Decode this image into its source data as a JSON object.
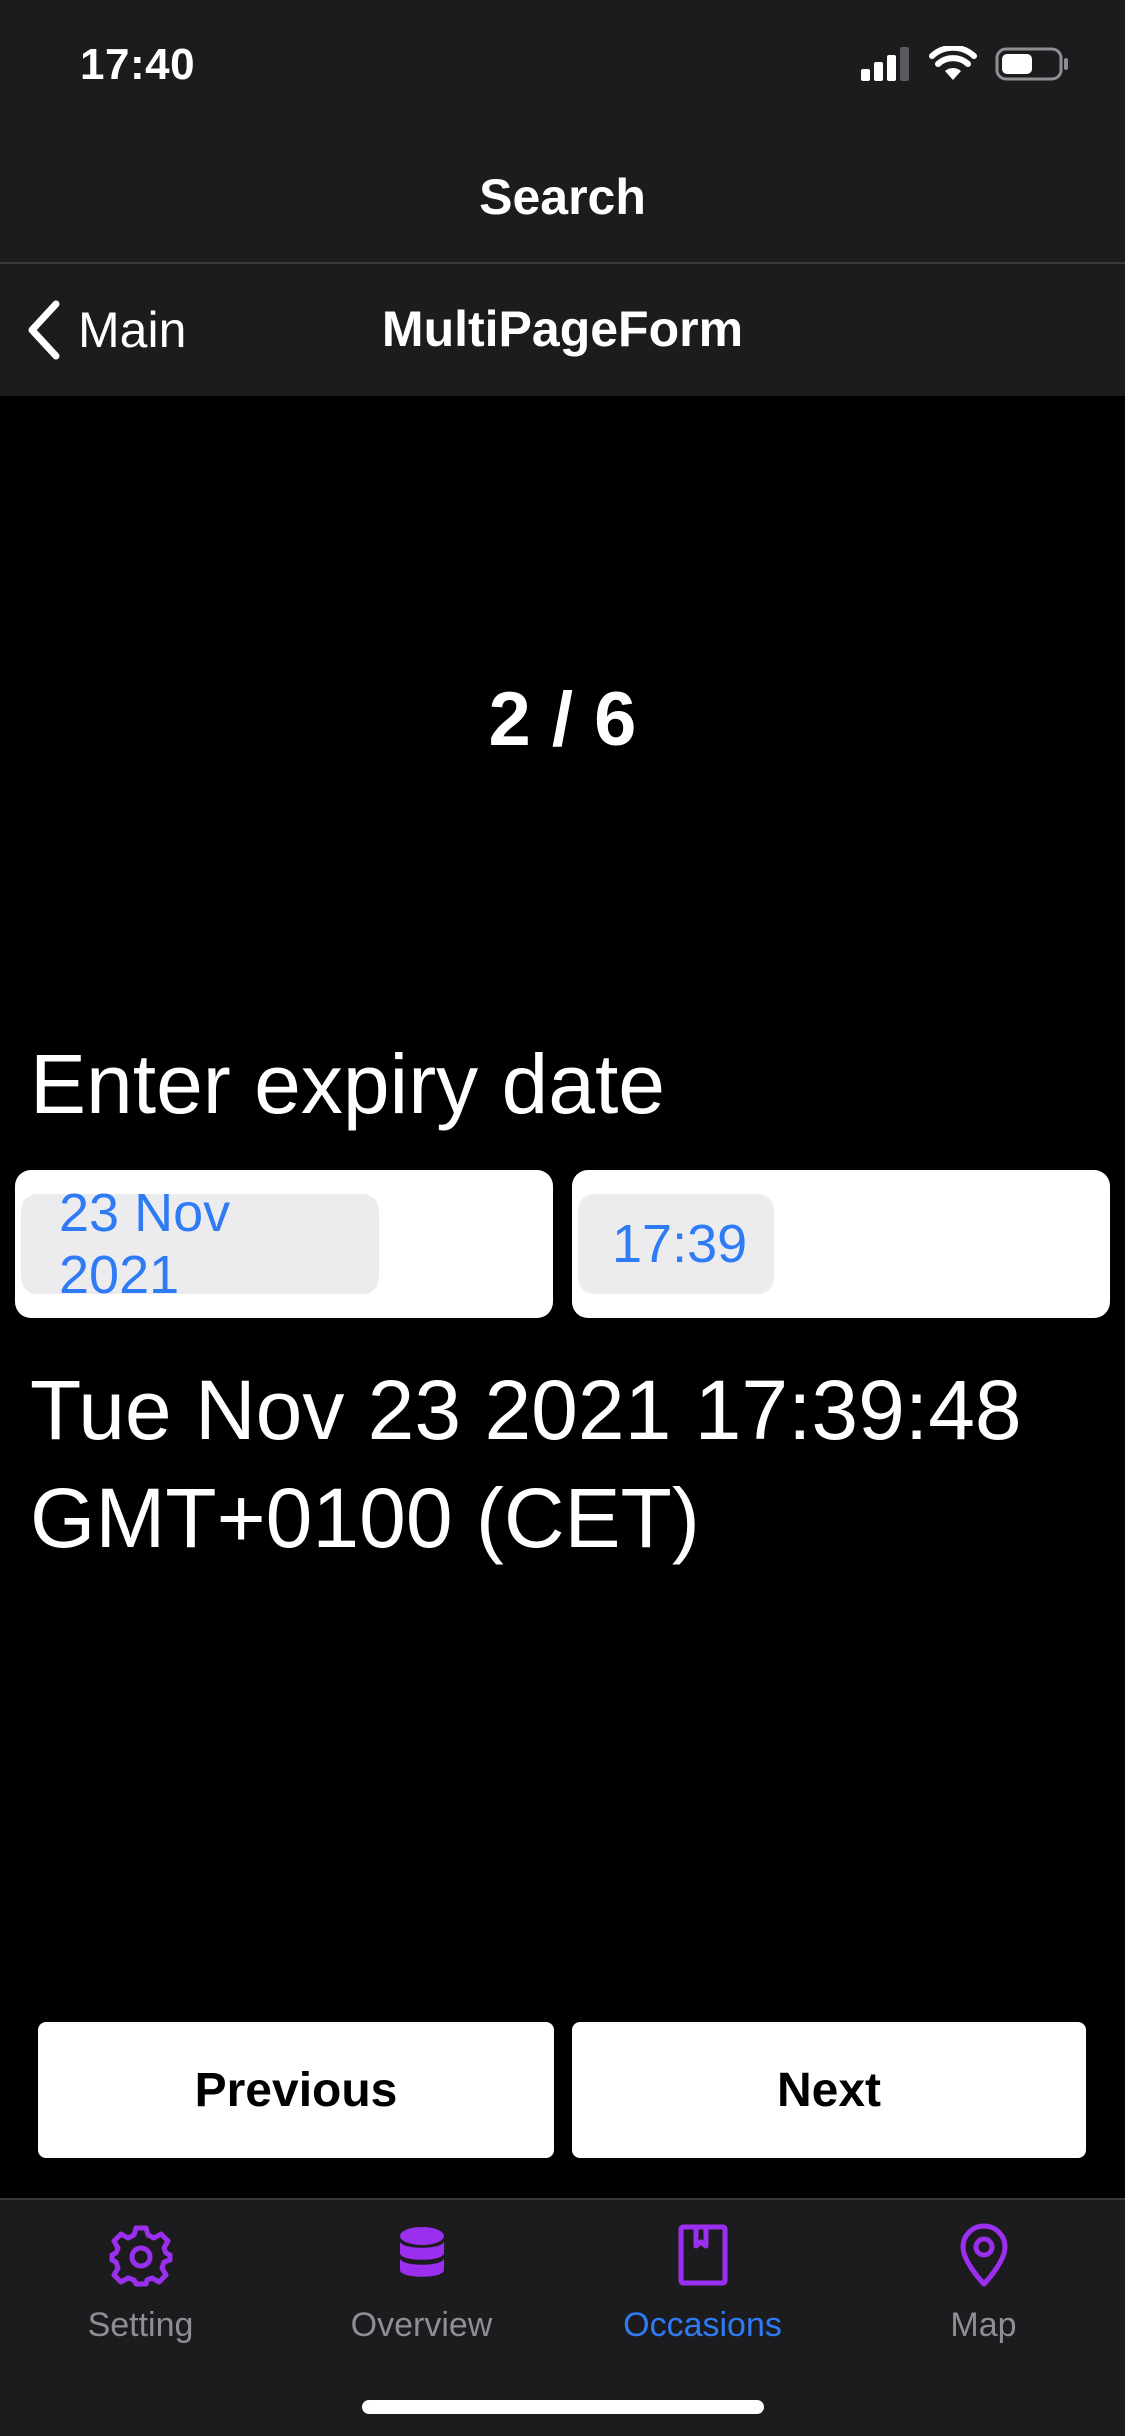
{
  "status_bar": {
    "time": "17:40",
    "battery_level": 0.55
  },
  "header": {
    "title": "Search"
  },
  "nav": {
    "back_label": "Main",
    "title": "MultiPageForm"
  },
  "form": {
    "page_indicator": "2 / 6",
    "field_label": "Enter expiry date",
    "date_value": "23 Nov 2021",
    "time_value": "17:39",
    "selected_value": "Tue Nov 23 2021 17:39:48 GMT+0100 (CET)",
    "previous_label": "Previous",
    "next_label": "Next"
  },
  "tabs": [
    {
      "label": "Setting",
      "icon": "gear-icon",
      "active": false
    },
    {
      "label": "Overview",
      "icon": "database-icon",
      "active": false
    },
    {
      "label": "Occasions",
      "icon": "bookmark-book-icon",
      "active": true
    },
    {
      "label": "Map",
      "icon": "map-pin-icon",
      "active": false
    }
  ],
  "colors": {
    "accent": "#2f7bf6",
    "tab_icon": "#9b2ff0",
    "bar_background": "#1c1c1e",
    "page_background": "#000000"
  }
}
